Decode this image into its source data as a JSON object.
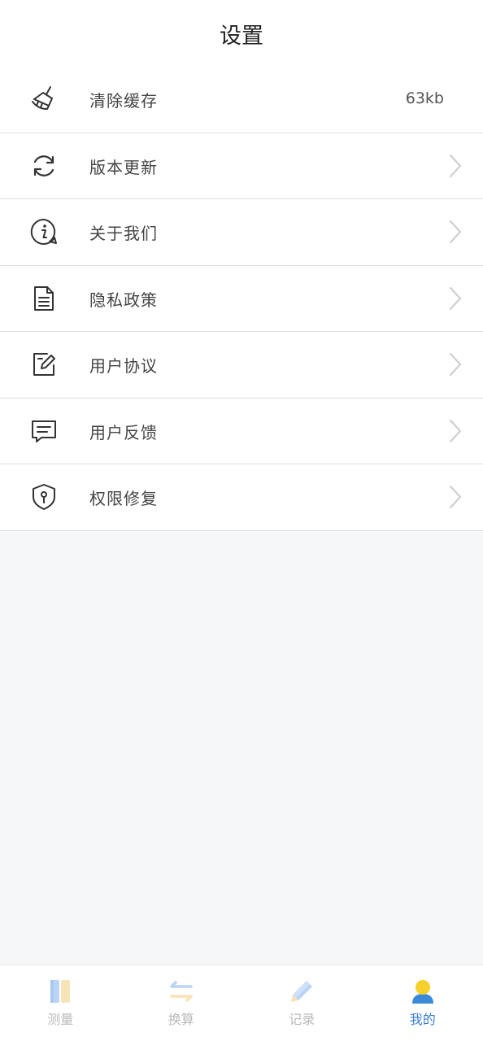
{
  "header": {
    "title": "设置"
  },
  "settings": {
    "items": [
      {
        "label": "清除缓存",
        "icon": "broom-icon",
        "value": "63kb"
      },
      {
        "label": "版本更新",
        "icon": "refresh-icon"
      },
      {
        "label": "关于我们",
        "icon": "info-icon"
      },
      {
        "label": "隐私政策",
        "icon": "document-icon"
      },
      {
        "label": "用户协议",
        "icon": "edit-icon"
      },
      {
        "label": "用户反馈",
        "icon": "message-icon"
      },
      {
        "label": "权限修复",
        "icon": "shield-icon"
      }
    ]
  },
  "tabbar": {
    "tabs": [
      {
        "label": "测量",
        "icon": "ruler-icon",
        "active": false
      },
      {
        "label": "换算",
        "icon": "exchange-icon",
        "active": false
      },
      {
        "label": "记录",
        "icon": "pencil-icon",
        "active": false
      },
      {
        "label": "我的",
        "icon": "user-icon",
        "active": true
      }
    ],
    "active_color": "#3a7fd0",
    "inactive_color": "#b9b9b9"
  }
}
